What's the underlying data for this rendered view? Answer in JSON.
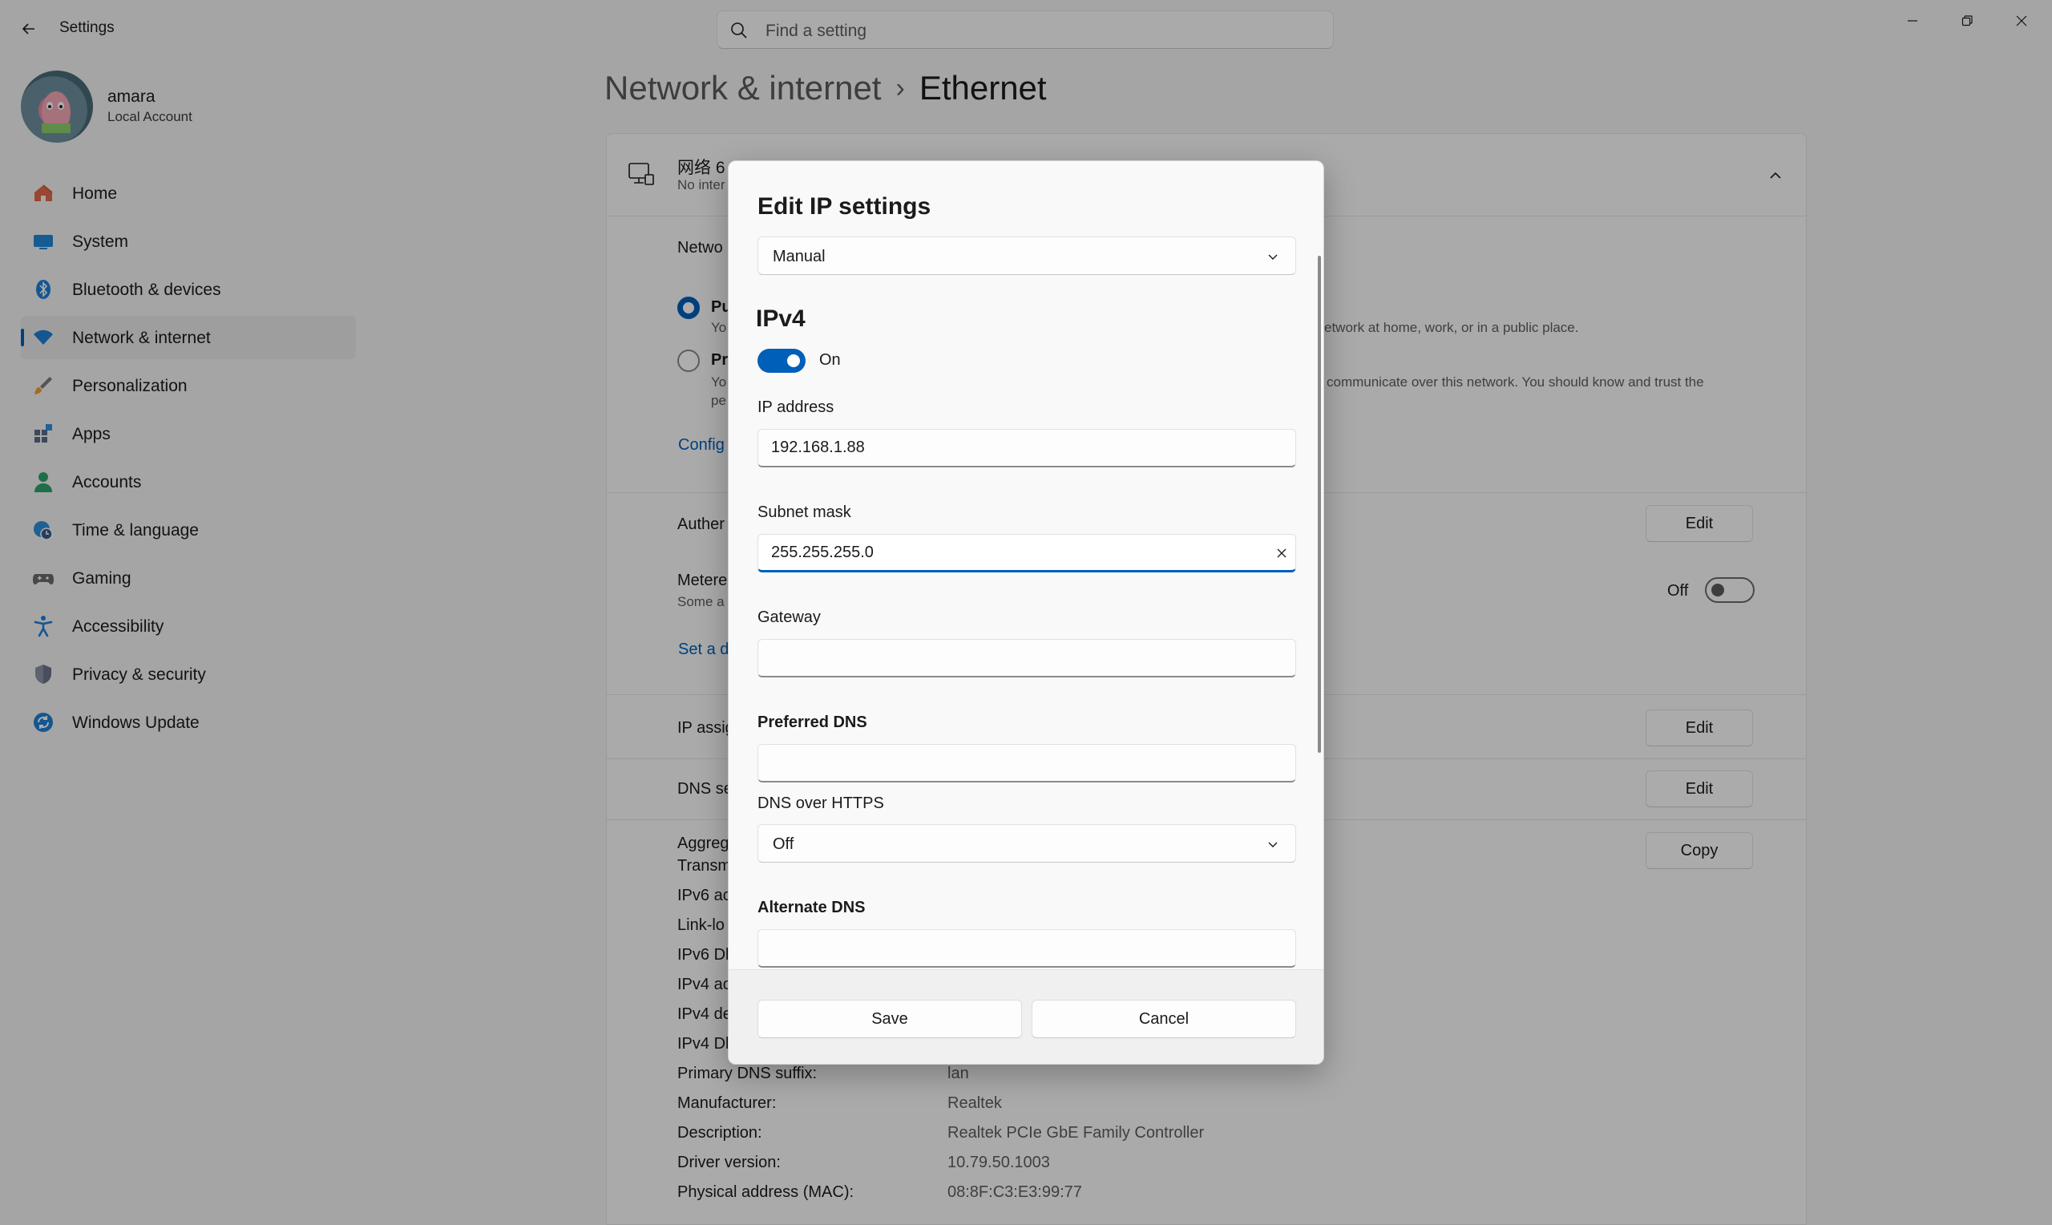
{
  "window": {
    "title": "Settings"
  },
  "search": {
    "placeholder": "Find a setting"
  },
  "profile": {
    "name": "amara",
    "account_type": "Local Account"
  },
  "sidebar": {
    "items": [
      {
        "label": "Home",
        "icon": "home-icon",
        "active": false
      },
      {
        "label": "System",
        "icon": "system-icon",
        "active": false
      },
      {
        "label": "Bluetooth & devices",
        "icon": "bluetooth-icon",
        "active": false
      },
      {
        "label": "Network & internet",
        "icon": "wifi-icon",
        "active": true
      },
      {
        "label": "Personalization",
        "icon": "brush-icon",
        "active": false
      },
      {
        "label": "Apps",
        "icon": "apps-icon",
        "active": false
      },
      {
        "label": "Accounts",
        "icon": "accounts-icon",
        "active": false
      },
      {
        "label": "Time & language",
        "icon": "globe-clock-icon",
        "active": false
      },
      {
        "label": "Gaming",
        "icon": "gamepad-icon",
        "active": false
      },
      {
        "label": "Accessibility",
        "icon": "accessibility-icon",
        "active": false
      },
      {
        "label": "Privacy & security",
        "icon": "shield-icon",
        "active": false
      },
      {
        "label": "Windows Update",
        "icon": "update-icon",
        "active": false
      }
    ]
  },
  "breadcrumb": {
    "parent": "Network & internet",
    "separator": "›",
    "current": "Ethernet"
  },
  "network_card": {
    "title": "网络 6",
    "status": "No inter",
    "network_profile_label": "Netwo",
    "public_label": "Pu",
    "public_desc_start": "Yo",
    "public_desc_end": "etwork at home, work, or in a public place.",
    "private_label": "Pr",
    "private_desc_start": "Yo",
    "private_desc_end": "communicate over this network. You should know and trust the",
    "private_desc_line2": "pe",
    "configure_link": "Config",
    "auth_label": "Auther",
    "metered_label": "Metere",
    "metered_desc": "Some a",
    "metered_state": "Off",
    "data_limit_link": "Set a d",
    "ip_assign_label": "IP assig",
    "dns_label": "DNS se",
    "edit_label": "Edit",
    "copy_label": "Copy",
    "props_partial": [
      "Aggreg",
      "Transm",
      "IPv6 ac",
      "Link-lo",
      "IPv6 Dl",
      "IPv4 ac",
      "IPv4 de",
      "IPv4 Dl"
    ],
    "props": [
      {
        "label": "Primary DNS suffix:",
        "value": "lan"
      },
      {
        "label": "Manufacturer:",
        "value": "Realtek"
      },
      {
        "label": "Description:",
        "value": "Realtek PCIe GbE Family Controller"
      },
      {
        "label": "Driver version:",
        "value": "10.79.50.1003"
      },
      {
        "label": "Physical address (MAC):",
        "value": "08:8F:C3:E3:99:77"
      }
    ]
  },
  "dialog": {
    "title": "Edit IP settings",
    "mode": "Manual",
    "section": "IPv4",
    "ipv4_toggle": "On",
    "ip_address_label": "IP address",
    "ip_address_value": "192.168.1.88",
    "subnet_label": "Subnet mask",
    "subnet_value": "255.255.255.0",
    "gateway_label": "Gateway",
    "gateway_value": "",
    "preferred_dns_label": "Preferred DNS",
    "preferred_dns_value": "",
    "doh_label": "DNS over HTTPS",
    "doh_value": "Off",
    "alternate_dns_label": "Alternate DNS",
    "save_label": "Save",
    "cancel_label": "Cancel"
  },
  "colors": {
    "accent": "#005fb8"
  }
}
